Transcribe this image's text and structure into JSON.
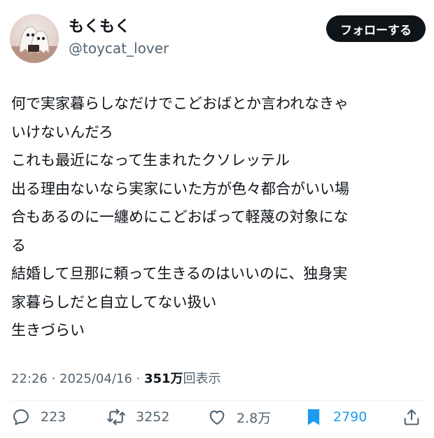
{
  "user": {
    "display_name": "もくもく",
    "handle": "@toycat_lover",
    "follow_label": "フォローする"
  },
  "tweet": {
    "lines": [
      "何で実家暮らしなだけでこどおばとか言われなきゃ",
      "いけないんだろ",
      "これも最近になって生まれたクソレッテル",
      "出る理由ないなら実家にいた方が色々都合がいい場",
      "合もあるのに一纏めにこどおばって軽蔑の対象にな",
      "る",
      "結婚して旦那に頼って生きるのはいいのに、独身実",
      "家暮らしだと自立してない扱い",
      "生きづらい"
    ]
  },
  "meta": {
    "time": "22:26",
    "separator": " · ",
    "date": "2025/04/16",
    "views": "351万",
    "views_label": "回表示"
  },
  "actions": {
    "reply_count": "223",
    "retweet_count": "3252",
    "like_count": "2.8万",
    "bookmark_count": "2790"
  },
  "colors": {
    "text": "#0f1419",
    "secondary": "#536471",
    "bookmark_active": "#1d9bf0",
    "follow_bg": "#0f1419"
  },
  "icons": {
    "reply": "reply-icon",
    "retweet": "retweet-icon",
    "like": "heart-icon",
    "bookmark": "bookmark-icon",
    "share": "share-icon"
  }
}
